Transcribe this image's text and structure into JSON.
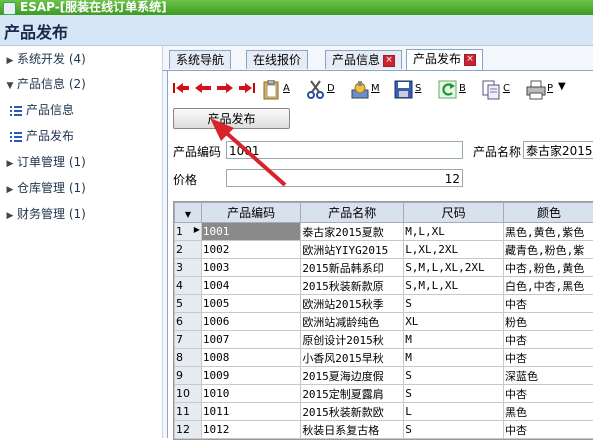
{
  "window": {
    "title": "ESAP-[服装在线订单系统]"
  },
  "header": {
    "title": "产品发布"
  },
  "sidebar": {
    "items": [
      {
        "label": "系统开发 (4)",
        "expanded": false,
        "level": 0
      },
      {
        "label": "产品信息 (2)",
        "expanded": true,
        "level": 0
      },
      {
        "label": "产品信息",
        "level": 1
      },
      {
        "label": "产品发布",
        "level": 1
      },
      {
        "label": "订单管理 (1)",
        "expanded": false,
        "level": 0
      },
      {
        "label": "仓库管理 (1)",
        "expanded": false,
        "level": 0
      },
      {
        "label": "财务管理 (1)",
        "expanded": false,
        "level": 0
      }
    ]
  },
  "tabs": [
    {
      "label": "系统导航",
      "closable": false,
      "active": false
    },
    {
      "label": "在线报价",
      "closable": false,
      "active": false
    },
    {
      "label": "产品信息",
      "closable": true,
      "active": false
    },
    {
      "label": "产品发布",
      "closable": true,
      "active": true
    }
  ],
  "toolbar": {
    "buttons": [
      {
        "icon": "first-record-icon",
        "key": ""
      },
      {
        "icon": "prev-record-icon",
        "key": ""
      },
      {
        "icon": "next-record-icon",
        "key": ""
      },
      {
        "icon": "last-record-icon",
        "key": ""
      },
      {
        "icon": "clipboard-add-icon",
        "key": "A"
      },
      {
        "icon": "scissors-delete-icon",
        "key": "D"
      },
      {
        "icon": "edit-modify-icon",
        "key": "M"
      },
      {
        "icon": "save-icon",
        "key": "S"
      },
      {
        "icon": "refresh-icon",
        "key": "B"
      },
      {
        "icon": "copy-icon",
        "key": "C"
      },
      {
        "icon": "printer-icon",
        "key": "P"
      }
    ],
    "publish_label": "产品发布"
  },
  "form": {
    "code_label": "产品编码",
    "code_value": "1001",
    "name_label": "产品名称",
    "name_value": "泰古家2015",
    "price_label": "价格",
    "price_value": "12"
  },
  "grid": {
    "columns": [
      "产品编码",
      "产品名称",
      "尺码",
      "颜色"
    ],
    "selected_row": 1,
    "rows": [
      {
        "n": "1",
        "code": "1001",
        "name": "泰古家2015夏款",
        "size": "M,L,XL",
        "color": "黑色,黄色,紫色"
      },
      {
        "n": "2",
        "code": "1002",
        "name": "欧洲站YIYG2015",
        "size": "L,XL,2XL",
        "color": "藏青色,粉色,紫"
      },
      {
        "n": "3",
        "code": "1003",
        "name": "2015新品韩系印",
        "size": "S,M,L,XL,2XL",
        "color": "中杏,粉色,黄色"
      },
      {
        "n": "4",
        "code": "1004",
        "name": "2015秋装新款原",
        "size": "S,M,L,XL",
        "color": "白色,中杏,黑色"
      },
      {
        "n": "5",
        "code": "1005",
        "name": "欧洲站2015秋季",
        "size": "S",
        "color": "中杏"
      },
      {
        "n": "6",
        "code": "1006",
        "name": "欧洲站减龄纯色",
        "size": "XL",
        "color": "粉色"
      },
      {
        "n": "7",
        "code": "1007",
        "name": "原创设计2015秋",
        "size": "M",
        "color": "中杏"
      },
      {
        "n": "8",
        "code": "1008",
        "name": "小香风2015早秋",
        "size": "M",
        "color": "中杏"
      },
      {
        "n": "9",
        "code": "1009",
        "name": "2015夏海边度假",
        "size": "S",
        "color": "深蓝色"
      },
      {
        "n": "10",
        "code": "1010",
        "name": "2015定制夏露肩",
        "size": "S",
        "color": "中杏"
      },
      {
        "n": "11",
        "code": "1011",
        "name": "2015秋装新款欧",
        "size": "L",
        "color": "黑色"
      },
      {
        "n": "12",
        "code": "1012",
        "name": "秋装日系复古格",
        "size": "S",
        "color": "中杏"
      }
    ]
  },
  "colors": {
    "titlebar": "#4aae2e",
    "header": "#d6e6f7",
    "annotation_arrow": "#d9232a"
  }
}
